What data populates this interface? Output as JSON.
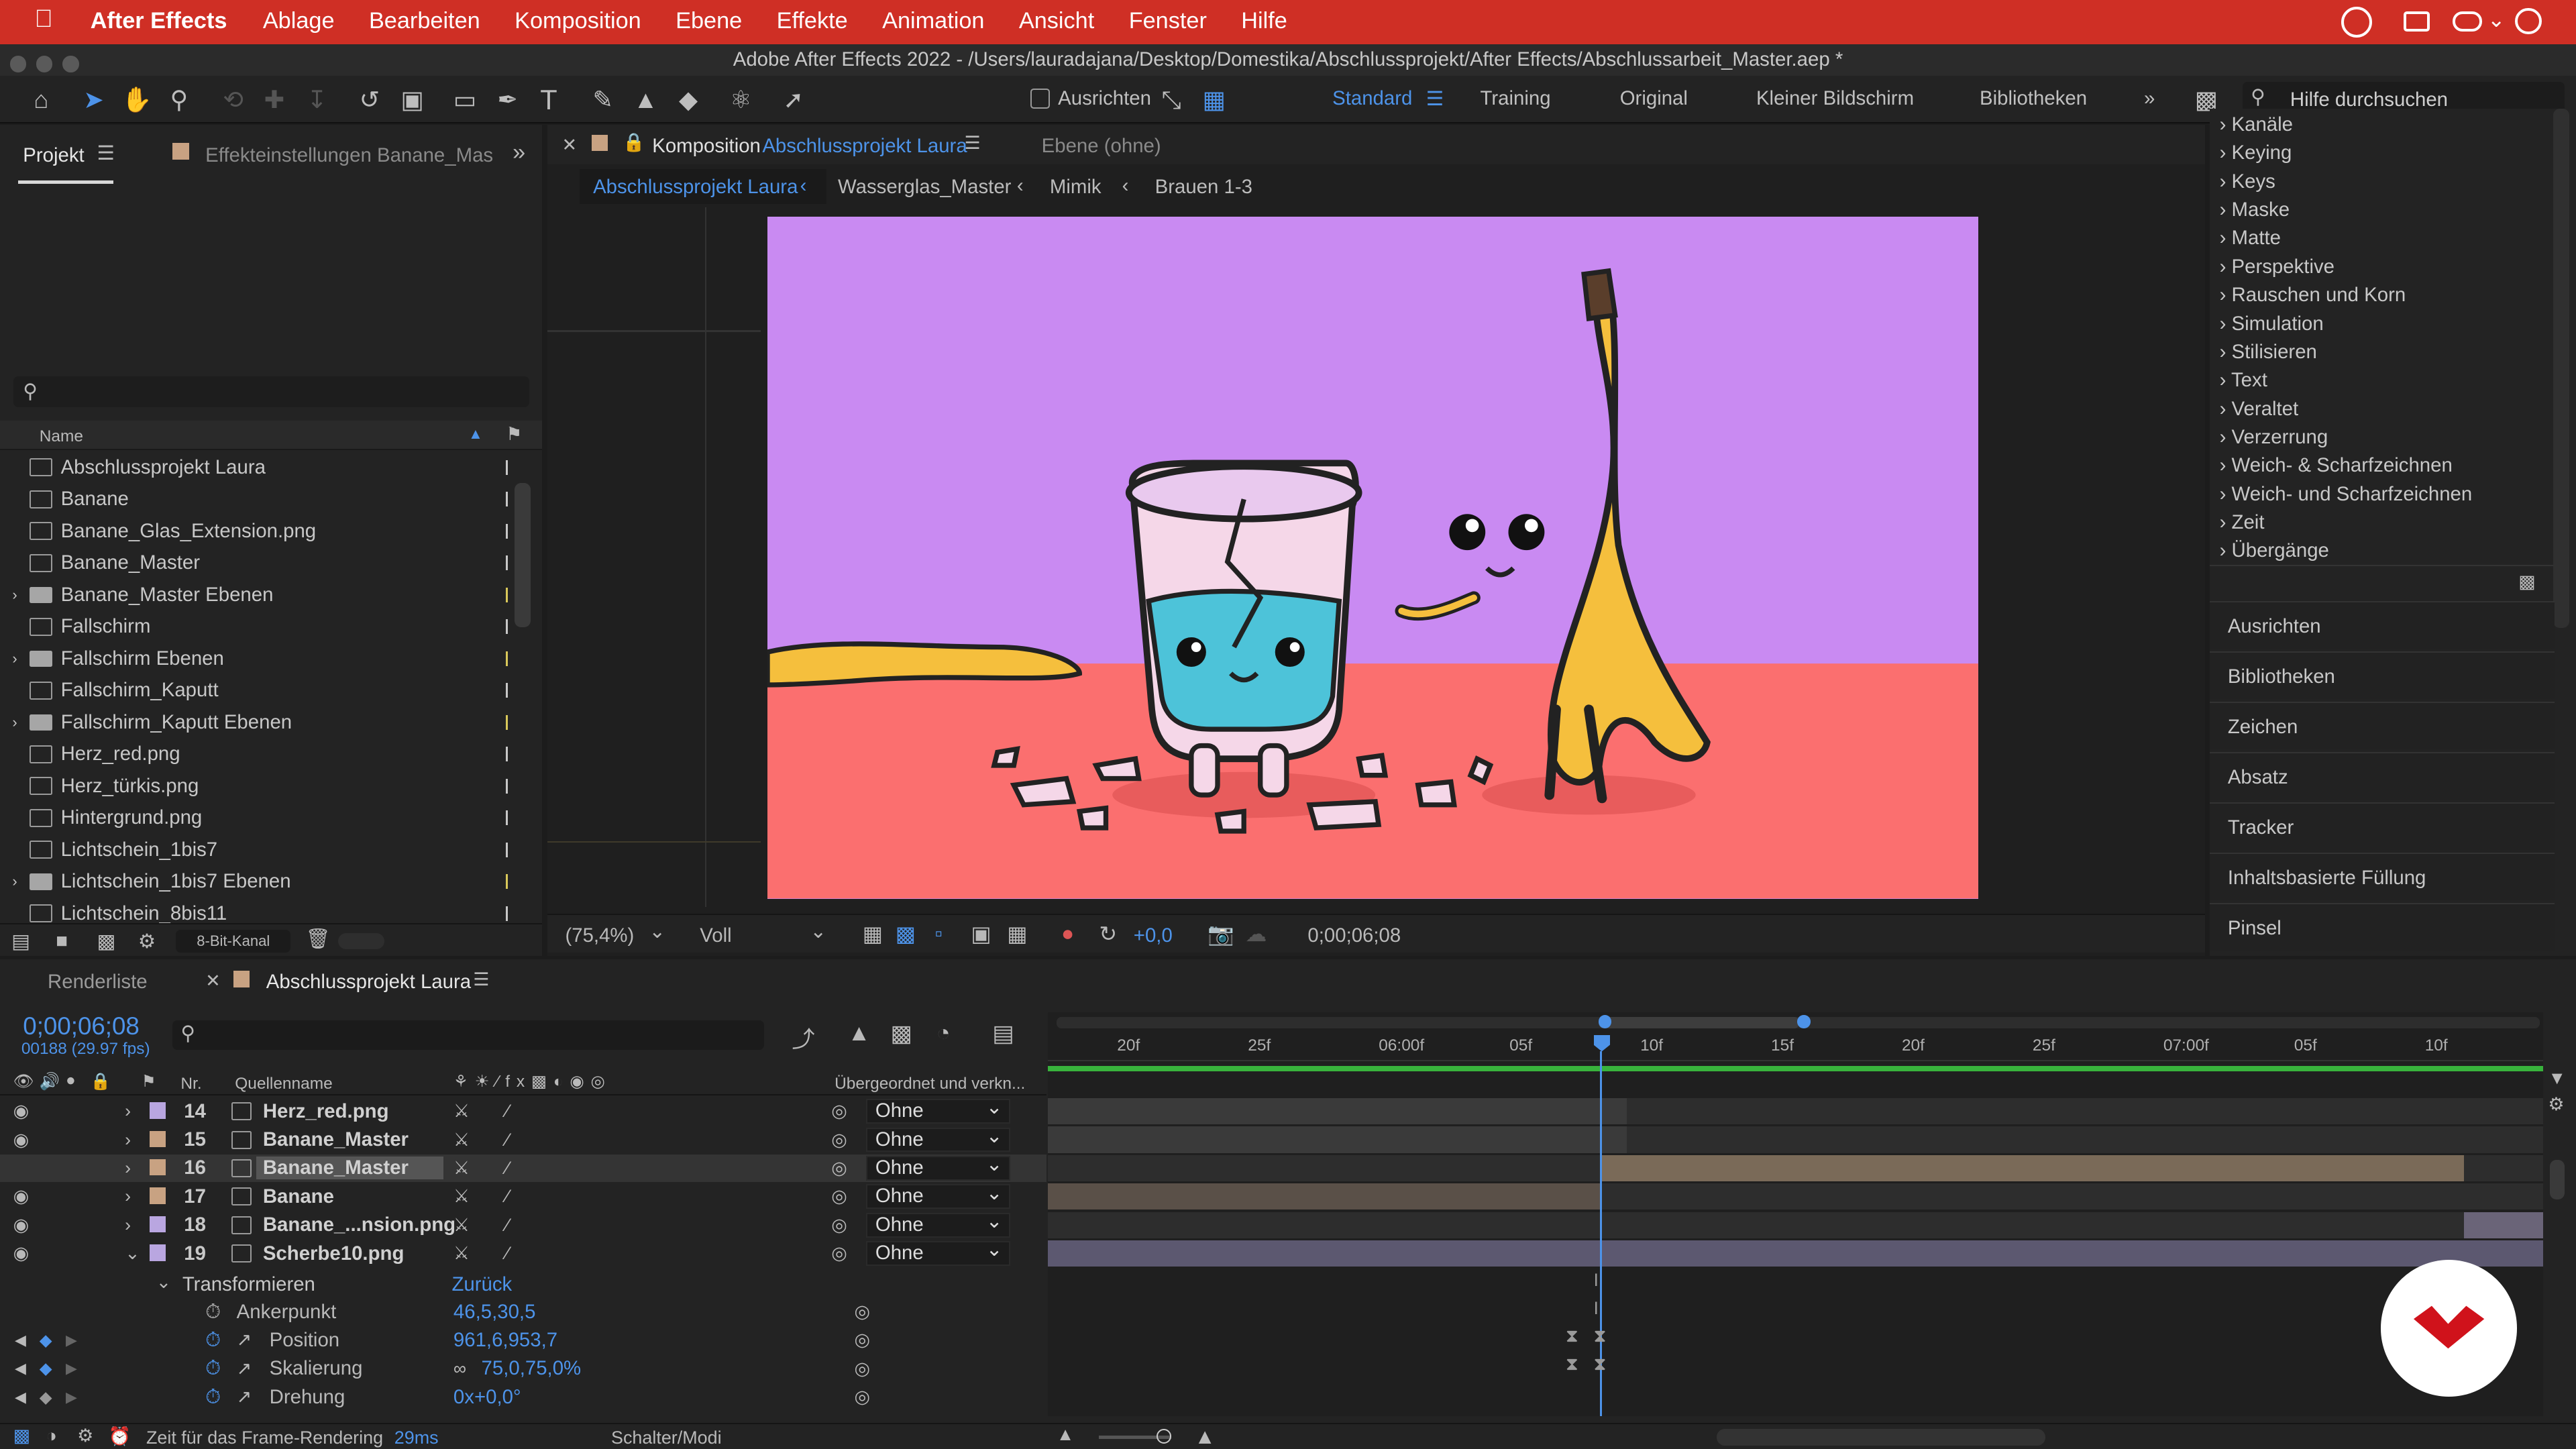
{
  "menubar": {
    "apple": "",
    "app": "After Effects",
    "items": [
      "Ablage",
      "Bearbeiten",
      "Komposition",
      "Ebene",
      "Effekte",
      "Animation",
      "Ansicht",
      "Fenster",
      "Hilfe"
    ]
  },
  "window": {
    "title": "Adobe After Effects 2022 - /Users/lauradajana/Desktop/Domestika/Abschlussprojekt/After Effects/Abschlussarbeit_Master.aep *"
  },
  "toolbar": {
    "snap_label": "Ausrichten",
    "workspaces": [
      "Standard",
      "Training",
      "Original",
      "Kleiner Bildschirm",
      "Bibliotheken"
    ],
    "active_workspace": "Standard",
    "help_placeholder": "Hilfe durchsuchen"
  },
  "project": {
    "tab": "Projekt",
    "effect_tab": "Effekteinstellungen Banane_Mas",
    "column_name": "Name",
    "bitdepth": "8-Bit-Kanal",
    "items": [
      {
        "name": "Abschlussprojekt Laura",
        "kind": "comp"
      },
      {
        "name": "Banane",
        "kind": "comp"
      },
      {
        "name": "Banane_Glas_Extension.png",
        "kind": "file"
      },
      {
        "name": "Banane_Master",
        "kind": "comp"
      },
      {
        "name": "Banane_Master Ebenen",
        "kind": "folder"
      },
      {
        "name": "Fallschirm",
        "kind": "comp"
      },
      {
        "name": "Fallschirm Ebenen",
        "kind": "folder"
      },
      {
        "name": "Fallschirm_Kaputt",
        "kind": "comp"
      },
      {
        "name": "Fallschirm_Kaputt Ebenen",
        "kind": "folder"
      },
      {
        "name": "Herz_red.png",
        "kind": "file"
      },
      {
        "name": "Herz_türkis.png",
        "kind": "file"
      },
      {
        "name": "Hintergrund.png",
        "kind": "file"
      },
      {
        "name": "Lichtschein_1bis7",
        "kind": "comp"
      },
      {
        "name": "Lichtschein_1bis7 Ebenen",
        "kind": "folder"
      },
      {
        "name": "Lichtschein_8bis11",
        "kind": "comp"
      }
    ]
  },
  "viewer": {
    "comp_tab_prefix": "Komposition",
    "comp_name": "Abschlussprojekt Laura",
    "layer_tab": "Ebene (ohne)",
    "breadcrumbs": [
      "Abschlussprojekt Laura",
      "Wasserglas_Master",
      "Mimik",
      "Brauen 1-3"
    ],
    "zoom": "(75,4%)",
    "quality": "Voll",
    "exposure": "+0,0",
    "timecode": "0;00;06;08"
  },
  "effects": {
    "items": [
      "Kanäle",
      "Keying",
      "Keys",
      "Maske",
      "Matte",
      "Perspektive",
      "Rauschen und Korn",
      "Simulation",
      "Stilisieren",
      "Text",
      "Veraltet",
      "Verzerrung",
      "Weich- & Scharfzeichnen",
      "Weich- und Scharfzeichnen",
      "Zeit",
      "Übergänge"
    ],
    "panels": [
      "Ausrichten",
      "Bibliotheken",
      "Zeichen",
      "Absatz",
      "Tracker",
      "Inhaltsbasierte Füllung",
      "Pinsel"
    ]
  },
  "timeline": {
    "tab_render": "Renderliste",
    "tab_comp": "Abschlussprojekt Laura",
    "timecode": "0;00;06;08",
    "frame_info": "00188 (29.97 fps)",
    "col_nr": "Nr.",
    "col_source": "Quellenname",
    "col_parent": "Übergeordnet und verkn...",
    "ruler": [
      "20f",
      "25f",
      "06:00f",
      "05f",
      "10f",
      "15f",
      "20f",
      "25f",
      "07:00f",
      "05f",
      "10f"
    ],
    "layers": [
      {
        "nr": "14",
        "name": "Herz_red.png",
        "parent": "Ohne",
        "color": "#b9a6e0"
      },
      {
        "nr": "15",
        "name": "Banane_Master",
        "parent": "Ohne",
        "color": "#c8a282"
      },
      {
        "nr": "16",
        "name": "Banane_Master",
        "parent": "Ohne",
        "color": "#c8a282"
      },
      {
        "nr": "17",
        "name": "Banane",
        "parent": "Ohne",
        "color": "#c8a282"
      },
      {
        "nr": "18",
        "name": "Banane_...nsion.png",
        "parent": "Ohne",
        "color": "#b9a6e0"
      },
      {
        "nr": "19",
        "name": "Scherbe10.png",
        "parent": "Ohne",
        "color": "#b9a6e0"
      }
    ],
    "transform": {
      "label": "Transformieren",
      "reset": "Zurück",
      "props": [
        {
          "name": "Ankerpunkt",
          "value": "46,5,30,5"
        },
        {
          "name": "Position",
          "value": "961,6,953,7"
        },
        {
          "name": "Skalierung",
          "value": "75,0,75,0%"
        },
        {
          "name": "Drehung",
          "value": "0x+0,0°"
        }
      ]
    }
  },
  "statusbar": {
    "render_label": "Zeit für das Frame-Rendering",
    "render_time": "29ms",
    "mode": "Schalter/Modi"
  },
  "colors": {
    "menubar": "#cf2f25",
    "accent": "#4d93e9",
    "scene_bg": "#c98af2",
    "scene_floor": "#fb6f6f"
  }
}
